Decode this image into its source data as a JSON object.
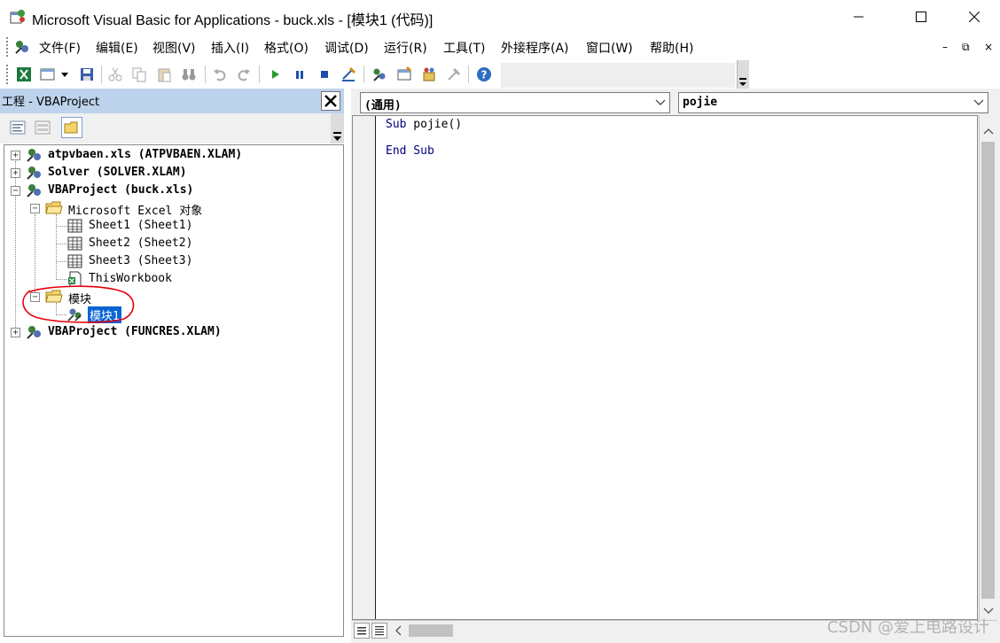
{
  "window": {
    "title": "Microsoft Visual Basic for Applications - buck.xls - [模块1 (代码)]"
  },
  "menu": {
    "items": [
      "文件(F)",
      "编辑(E)",
      "视图(V)",
      "插入(I)",
      "格式(O)",
      "调试(D)",
      "运行(R)",
      "工具(T)",
      "外接程序(A)",
      "窗口(W)",
      "帮助(H)"
    ],
    "mdi_minimize": "–",
    "mdi_restore": "⧉",
    "mdi_close": "×"
  },
  "project_pane": {
    "title": "工程 - VBAProject",
    "tree": [
      {
        "label": "atpvbaen.xls (ATPVBAEN.XLAM)",
        "bold": true
      },
      {
        "label": "Solver (SOLVER.XLAM)",
        "bold": true
      },
      {
        "label": "VBAProject (buck.xls)",
        "bold": true
      },
      {
        "label": "Microsoft Excel 对象",
        "bold": false
      },
      {
        "label": "Sheet1 (Sheet1)",
        "bold": false
      },
      {
        "label": "Sheet2 (Sheet2)",
        "bold": false
      },
      {
        "label": "Sheet3 (Sheet3)",
        "bold": false
      },
      {
        "label": "ThisWorkbook",
        "bold": false
      },
      {
        "label": "模块",
        "bold": false
      },
      {
        "label": "模块1",
        "bold": false,
        "selected": true
      },
      {
        "label": "VBAProject (FUNCRES.XLAM)",
        "bold": true
      }
    ]
  },
  "code_pane": {
    "object_combo": "(通用)",
    "procedure_combo": "pojie",
    "lines": [
      {
        "keyword": "Sub",
        "rest": " pojie()"
      },
      {
        "keyword": "End Sub",
        "rest": ""
      }
    ]
  },
  "watermark": "CSDN @爱上电路设计",
  "colors": {
    "pane_header": "#bdd3ec",
    "selection": "#0a64d4",
    "keyword": "#00007f",
    "annotation": "#e8000b"
  }
}
